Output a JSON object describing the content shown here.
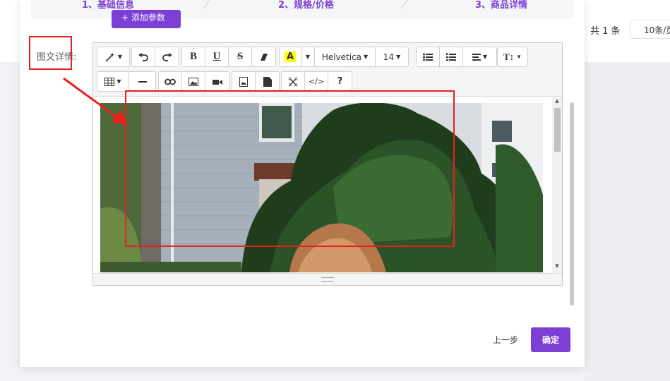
{
  "pager": {
    "total": "共 1 条",
    "page_size": "10条/页"
  },
  "steps": [
    {
      "label": "1、基础信息"
    },
    {
      "label": "2、规格/价格"
    },
    {
      "label": "3、商品详情"
    }
  ],
  "add_param_label": "+ 添加参数",
  "form": {
    "detail_label": "图文详情:"
  },
  "toolbar": {
    "font_name": "Helvetica",
    "font_size": "14",
    "text_height_label": "T↕",
    "help_label": "?",
    "code_label": "</>",
    "bold": "B",
    "underline": "U",
    "strike": "S",
    "highlight": "A"
  },
  "footer": {
    "prev_label": "上一步",
    "confirm_label": "确定"
  },
  "colors": {
    "accent": "#7b3fd6",
    "annotation": "#e8201a",
    "highlight": "#ffff00"
  }
}
